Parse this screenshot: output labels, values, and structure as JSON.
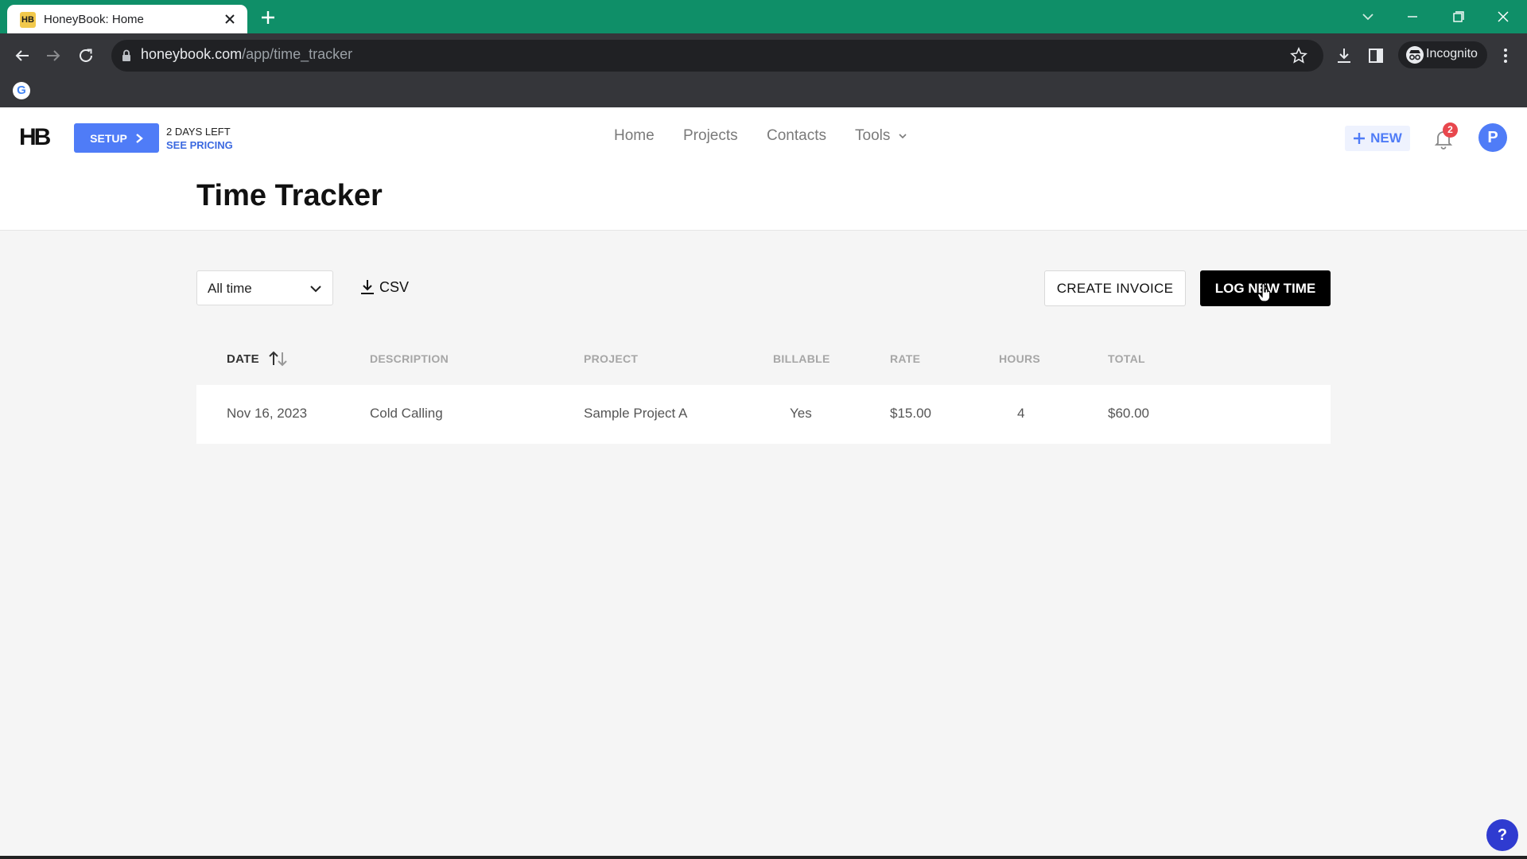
{
  "browser": {
    "tab_title": "HoneyBook: Home",
    "tab_favicon": "HB",
    "url_host": "honeybook.com",
    "url_path": "/app/time_tracker",
    "profile_label": "Incognito",
    "bookmark_icon": "G",
    "colors": {
      "tabstrip": "#0f8f68",
      "toolbar": "#35363a"
    }
  },
  "header": {
    "logo": "HB",
    "setup_label": "SETUP",
    "days_left": "2 DAYS LEFT",
    "see_pricing": "SEE PRICING",
    "nav": [
      "Home",
      "Projects",
      "Contacts",
      "Tools"
    ],
    "new_label": "NEW",
    "notification_count": "2",
    "avatar_initial": "P",
    "colors": {
      "accent": "#4f7cf7",
      "badge": "#e8474d"
    }
  },
  "page": {
    "title": "Time Tracker"
  },
  "controls": {
    "date_filter": "All time",
    "csv_label": "CSV",
    "create_invoice": "CREATE INVOICE",
    "log_new_time": "LOG NEW TIME"
  },
  "table": {
    "headers": [
      "DATE",
      "DESCRIPTION",
      "PROJECT",
      "BILLABLE",
      "RATE",
      "HOURS",
      "TOTAL"
    ],
    "rows": [
      [
        "Nov 16, 2023",
        "Cold Calling",
        "Sample Project A",
        "Yes",
        "$15.00",
        "4",
        "$60.00"
      ]
    ]
  },
  "help_label": "?"
}
